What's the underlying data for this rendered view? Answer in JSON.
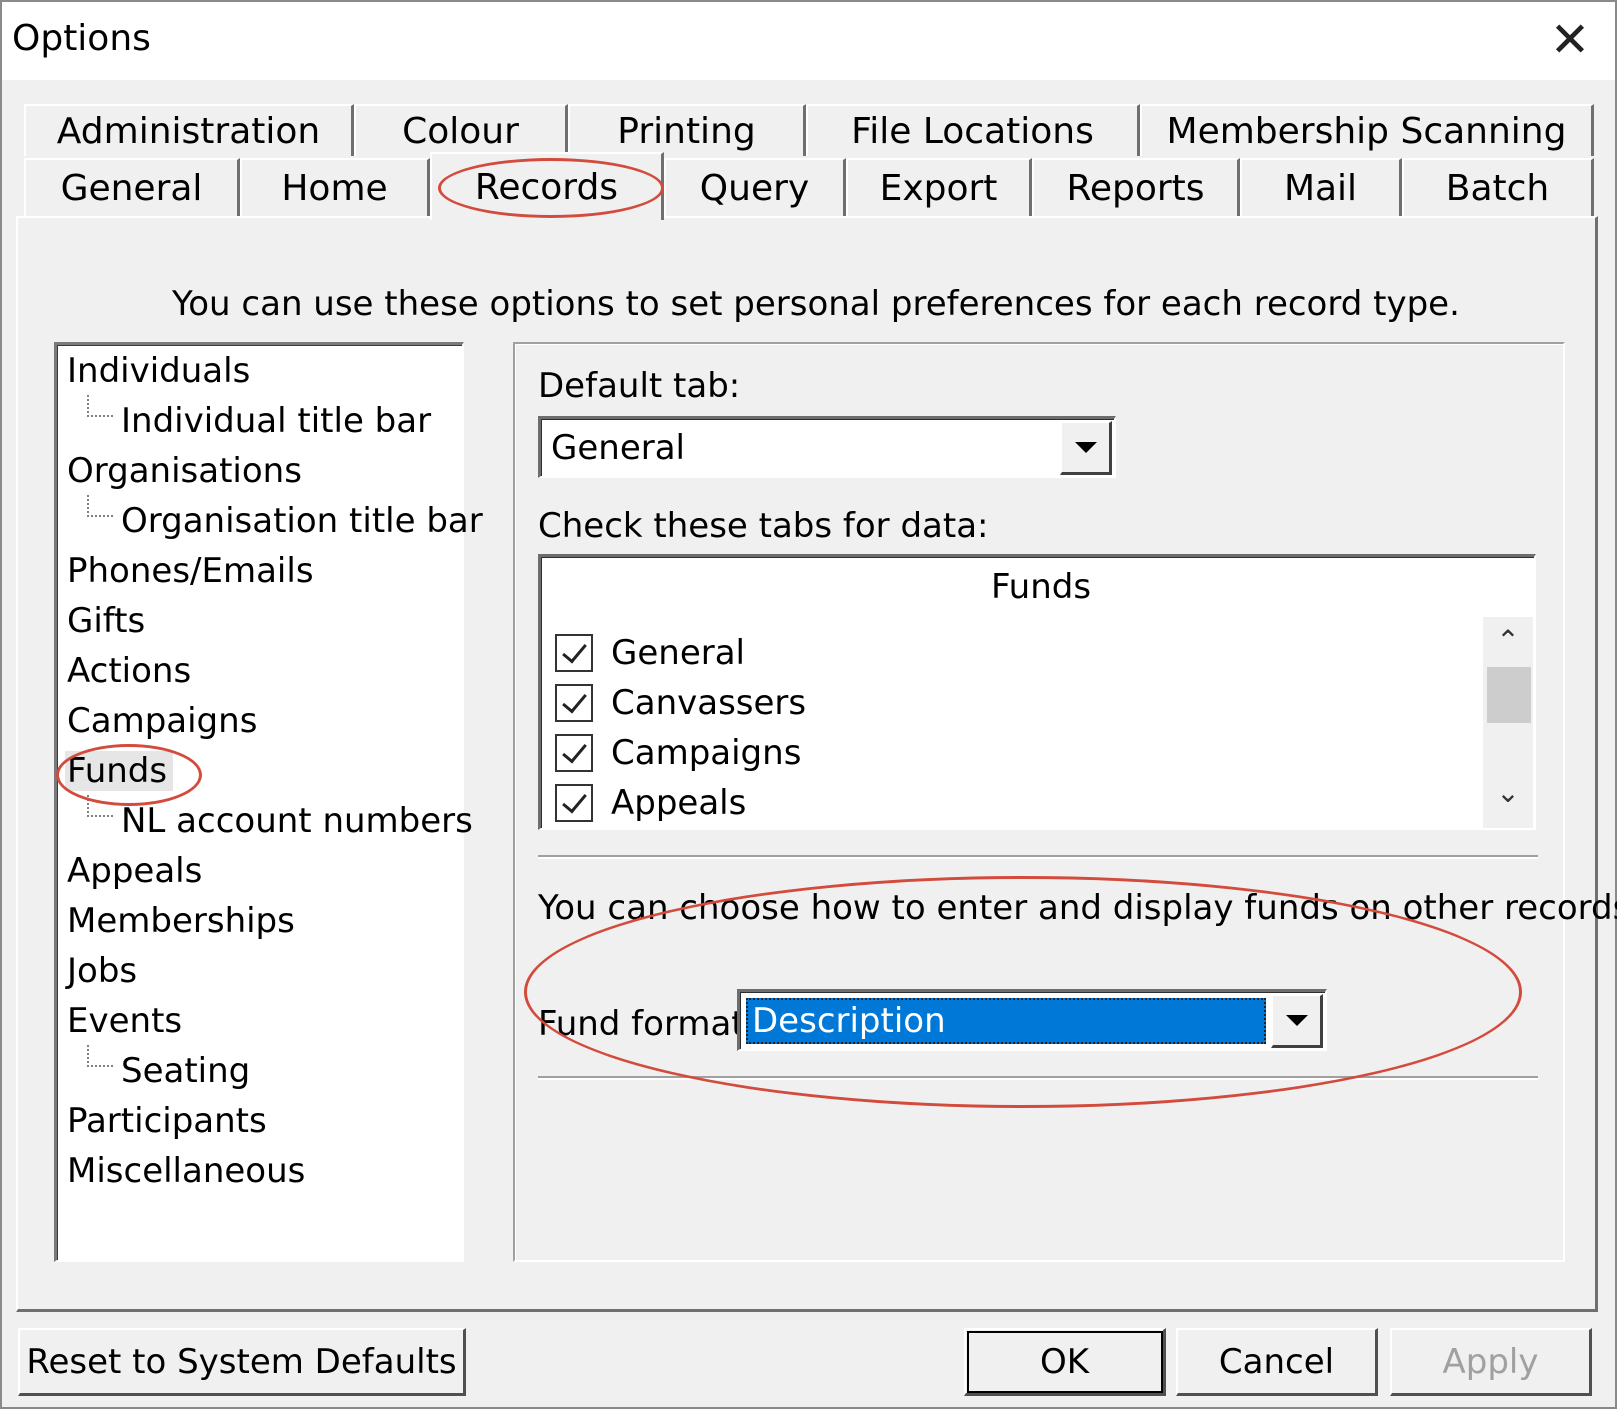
{
  "window": {
    "title": "Options",
    "close_glyph": "✕"
  },
  "tabs_row1": [
    {
      "label": "Administration"
    },
    {
      "label": "Colour"
    },
    {
      "label": "Printing"
    },
    {
      "label": "File Locations"
    },
    {
      "label": "Membership Scanning"
    }
  ],
  "tabs_row2": [
    {
      "label": "General"
    },
    {
      "label": "Home"
    },
    {
      "label": "Records",
      "active": true
    },
    {
      "label": "Query"
    },
    {
      "label": "Export"
    },
    {
      "label": "Reports"
    },
    {
      "label": "Mail"
    },
    {
      "label": "Batch"
    }
  ],
  "intro": "You can use these options to set personal preferences for each record type.",
  "tree": [
    {
      "label": "Individuals"
    },
    {
      "label": "Individual title bar"
    },
    {
      "label": "Organisations"
    },
    {
      "label": "Organisation title bar"
    },
    {
      "label": "Phones/Emails"
    },
    {
      "label": "Gifts"
    },
    {
      "label": "Actions"
    },
    {
      "label": "Campaigns"
    },
    {
      "label": "Funds",
      "selected": true
    },
    {
      "label": "NL account numbers"
    },
    {
      "label": "Appeals"
    },
    {
      "label": "Memberships"
    },
    {
      "label": "Jobs"
    },
    {
      "label": "Events"
    },
    {
      "label": "Seating"
    },
    {
      "label": "Participants"
    },
    {
      "label": "Miscellaneous"
    }
  ],
  "default_tab": {
    "label": "Default tab:",
    "value": "General"
  },
  "check_tabs": {
    "label": "Check these tabs for data:",
    "header": "Funds",
    "items": [
      {
        "label": "General",
        "checked": true
      },
      {
        "label": "Canvassers",
        "checked": true
      },
      {
        "label": "Campaigns",
        "checked": true
      },
      {
        "label": "Appeals",
        "checked": true
      }
    ]
  },
  "fund_note": "You can choose how to enter and display funds on other records.",
  "fund_format": {
    "label": "Fund format:",
    "value": "Description"
  },
  "buttons": {
    "reset": "Reset to System Defaults",
    "ok": "OK",
    "cancel": "Cancel",
    "apply": "Apply"
  },
  "colors": {
    "selection": "#0078d7",
    "annotation": "#d24b3c",
    "face": "#f0f0f0"
  }
}
